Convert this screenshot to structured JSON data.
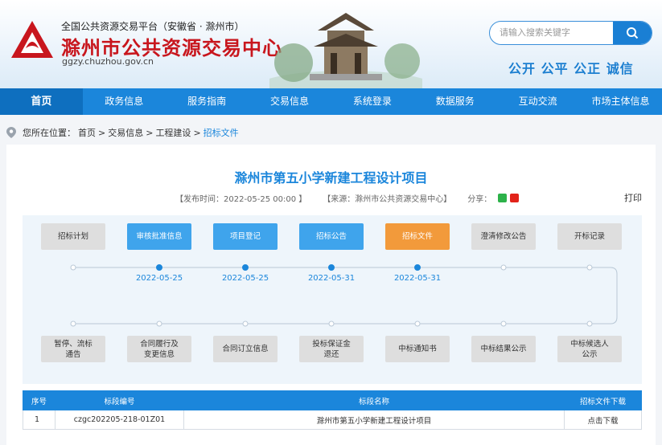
{
  "header": {
    "platform_sub": "全国公共资源交易平台（安徽省 · 滁州市）",
    "site_title": "滁州市公共资源交易中心",
    "domain": "ggzy.chuzhou.gov.cn",
    "search_placeholder": "请输入搜索关键字",
    "slogan": "公开 公平 公正 诚信"
  },
  "nav": {
    "items": [
      {
        "label": "首页",
        "active": true
      },
      {
        "label": "政务信息"
      },
      {
        "label": "服务指南"
      },
      {
        "label": "交易信息"
      },
      {
        "label": "系统登录"
      },
      {
        "label": "数据服务"
      },
      {
        "label": "互动交流"
      },
      {
        "label": "市场主体信息"
      }
    ]
  },
  "breadcrumb": {
    "prefix": "您所在位置：",
    "items": [
      "首页",
      ">",
      "交易信息",
      ">",
      "工程建设",
      ">"
    ],
    "current": "招标文件"
  },
  "article": {
    "title": "滁州市第五小学新建工程设计项目",
    "publish_time": "【发布时间：2022-05-25 00:00 】",
    "source": "【来源：滁州市公共资源交易中心】",
    "share_label": "分享：",
    "print_label": "打印"
  },
  "flow": {
    "top_steps": [
      {
        "label": "招标计划",
        "state": "grey",
        "date": ""
      },
      {
        "label": "审核批准信息",
        "state": "blue",
        "date": "2022-05-25"
      },
      {
        "label": "项目登记",
        "state": "blue",
        "date": "2022-05-25"
      },
      {
        "label": "招标公告",
        "state": "blue",
        "date": "2022-05-31"
      },
      {
        "label": "招标文件",
        "state": "orange",
        "date": "2022-05-31"
      },
      {
        "label": "澄清修改公告",
        "state": "grey",
        "date": ""
      },
      {
        "label": "开标记录",
        "state": "grey",
        "date": ""
      }
    ],
    "bottom_steps": [
      {
        "label": "暂停、流标\n通告",
        "state": "grey"
      },
      {
        "label": "合同履行及\n变更信息",
        "state": "grey"
      },
      {
        "label": "合同订立信息",
        "state": "grey"
      },
      {
        "label": "投标保证金\n退还",
        "state": "grey"
      },
      {
        "label": "中标通知书",
        "state": "grey"
      },
      {
        "label": "中标结果公示",
        "state": "grey"
      },
      {
        "label": "中标候选人\n公示",
        "state": "grey"
      }
    ]
  },
  "table": {
    "headers": [
      "序号",
      "标段编号",
      "标段名称",
      "招标文件下载"
    ],
    "rows": [
      [
        "1",
        "czgc202205-218-01Z01",
        "滁州市第五小学新建工程设计项目",
        "点击下载"
      ]
    ]
  },
  "colors": {
    "primary": "#1b86db",
    "brand_red": "#c8161d",
    "active_step": "#f29a3b",
    "done_step": "#3fa4ec"
  }
}
